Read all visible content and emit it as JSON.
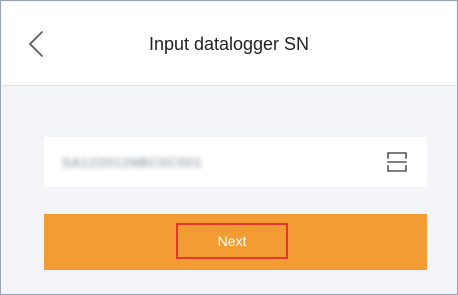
{
  "header": {
    "title": "Input datalogger SN",
    "back_icon": "chevron-left-icon"
  },
  "sn_field": {
    "value": "SA1220129BC0C001",
    "scan_icon": "scan-icon",
    "obscured": true
  },
  "next_button": {
    "label": "Next",
    "color": "#f39c33",
    "highlight_color": "#e2382d"
  }
}
